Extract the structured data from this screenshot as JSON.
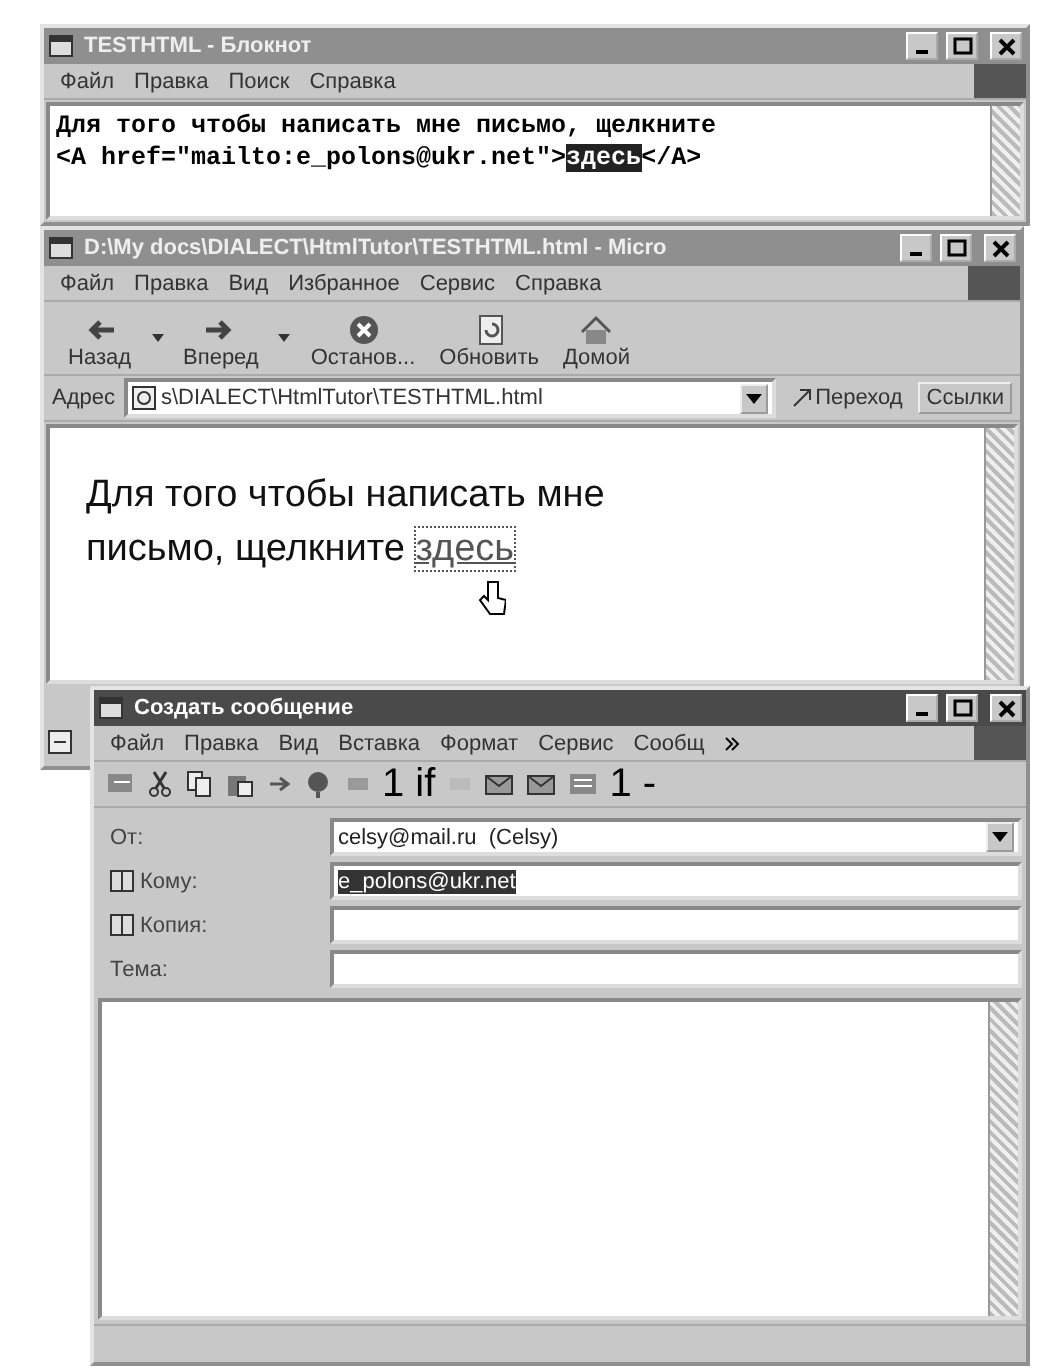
{
  "notepad": {
    "title": "TESTHTML - Блокнот",
    "active": false,
    "menu": [
      "Файл",
      "Правка",
      "Поиск",
      "Справка"
    ],
    "lines": [
      [
        {
          "text": "Для того чтобы написать мне письмо, щелкните",
          "selected": false
        }
      ],
      [
        {
          "text": "<A href=\"mailto:e_polons@ukr.net\">",
          "selected": false
        },
        {
          "text": "здесь",
          "selected": true
        },
        {
          "text": "</A>",
          "selected": false
        }
      ]
    ]
  },
  "browser": {
    "title": "D:\\My docs\\DIALECT\\HtmlTutor\\TESTHTML.html - Micro",
    "active": false,
    "menu": [
      "Файл",
      "Правка",
      "Вид",
      "Избранное",
      "Сервис",
      "Справка"
    ],
    "toolbar": [
      {
        "kind": "back",
        "label": "Назад",
        "dropdown": true
      },
      {
        "kind": "forward",
        "label": "Вперед",
        "dropdown": true
      },
      {
        "kind": "stop",
        "label": "Останов...",
        "dropdown": false
      },
      {
        "kind": "refresh",
        "label": "Обновить",
        "dropdown": false
      },
      {
        "kind": "home",
        "label": "Домой",
        "dropdown": false
      }
    ],
    "address": {
      "label": "Адрес",
      "value": "s\\DIALECT\\HtmlTutor\\TESTHTML.html",
      "go": "Переход",
      "links": "Ссылки"
    },
    "content": {
      "text": "Для того чтобы написать мне письмо, щелкните",
      "link": "здесь"
    }
  },
  "compose": {
    "title": "Создать сообщение",
    "active": true,
    "menu": [
      "Файл",
      "Правка",
      "Вид",
      "Вставка",
      "Формат",
      "Сервис",
      "Сообщ"
    ],
    "toolbar_texts": [
      "1 if",
      "1 -"
    ],
    "fields": [
      {
        "label": "От:",
        "kind": "dropdown",
        "value": "celsy@mail.ru  (Celsy)",
        "selected": false
      },
      {
        "label": "Кому:",
        "kind": "address",
        "value": "e_polons@ukr.net",
        "selected": true
      },
      {
        "label": "Копия:",
        "kind": "address"
      },
      {
        "label": "Тема:",
        "kind": "plain"
      }
    ]
  }
}
